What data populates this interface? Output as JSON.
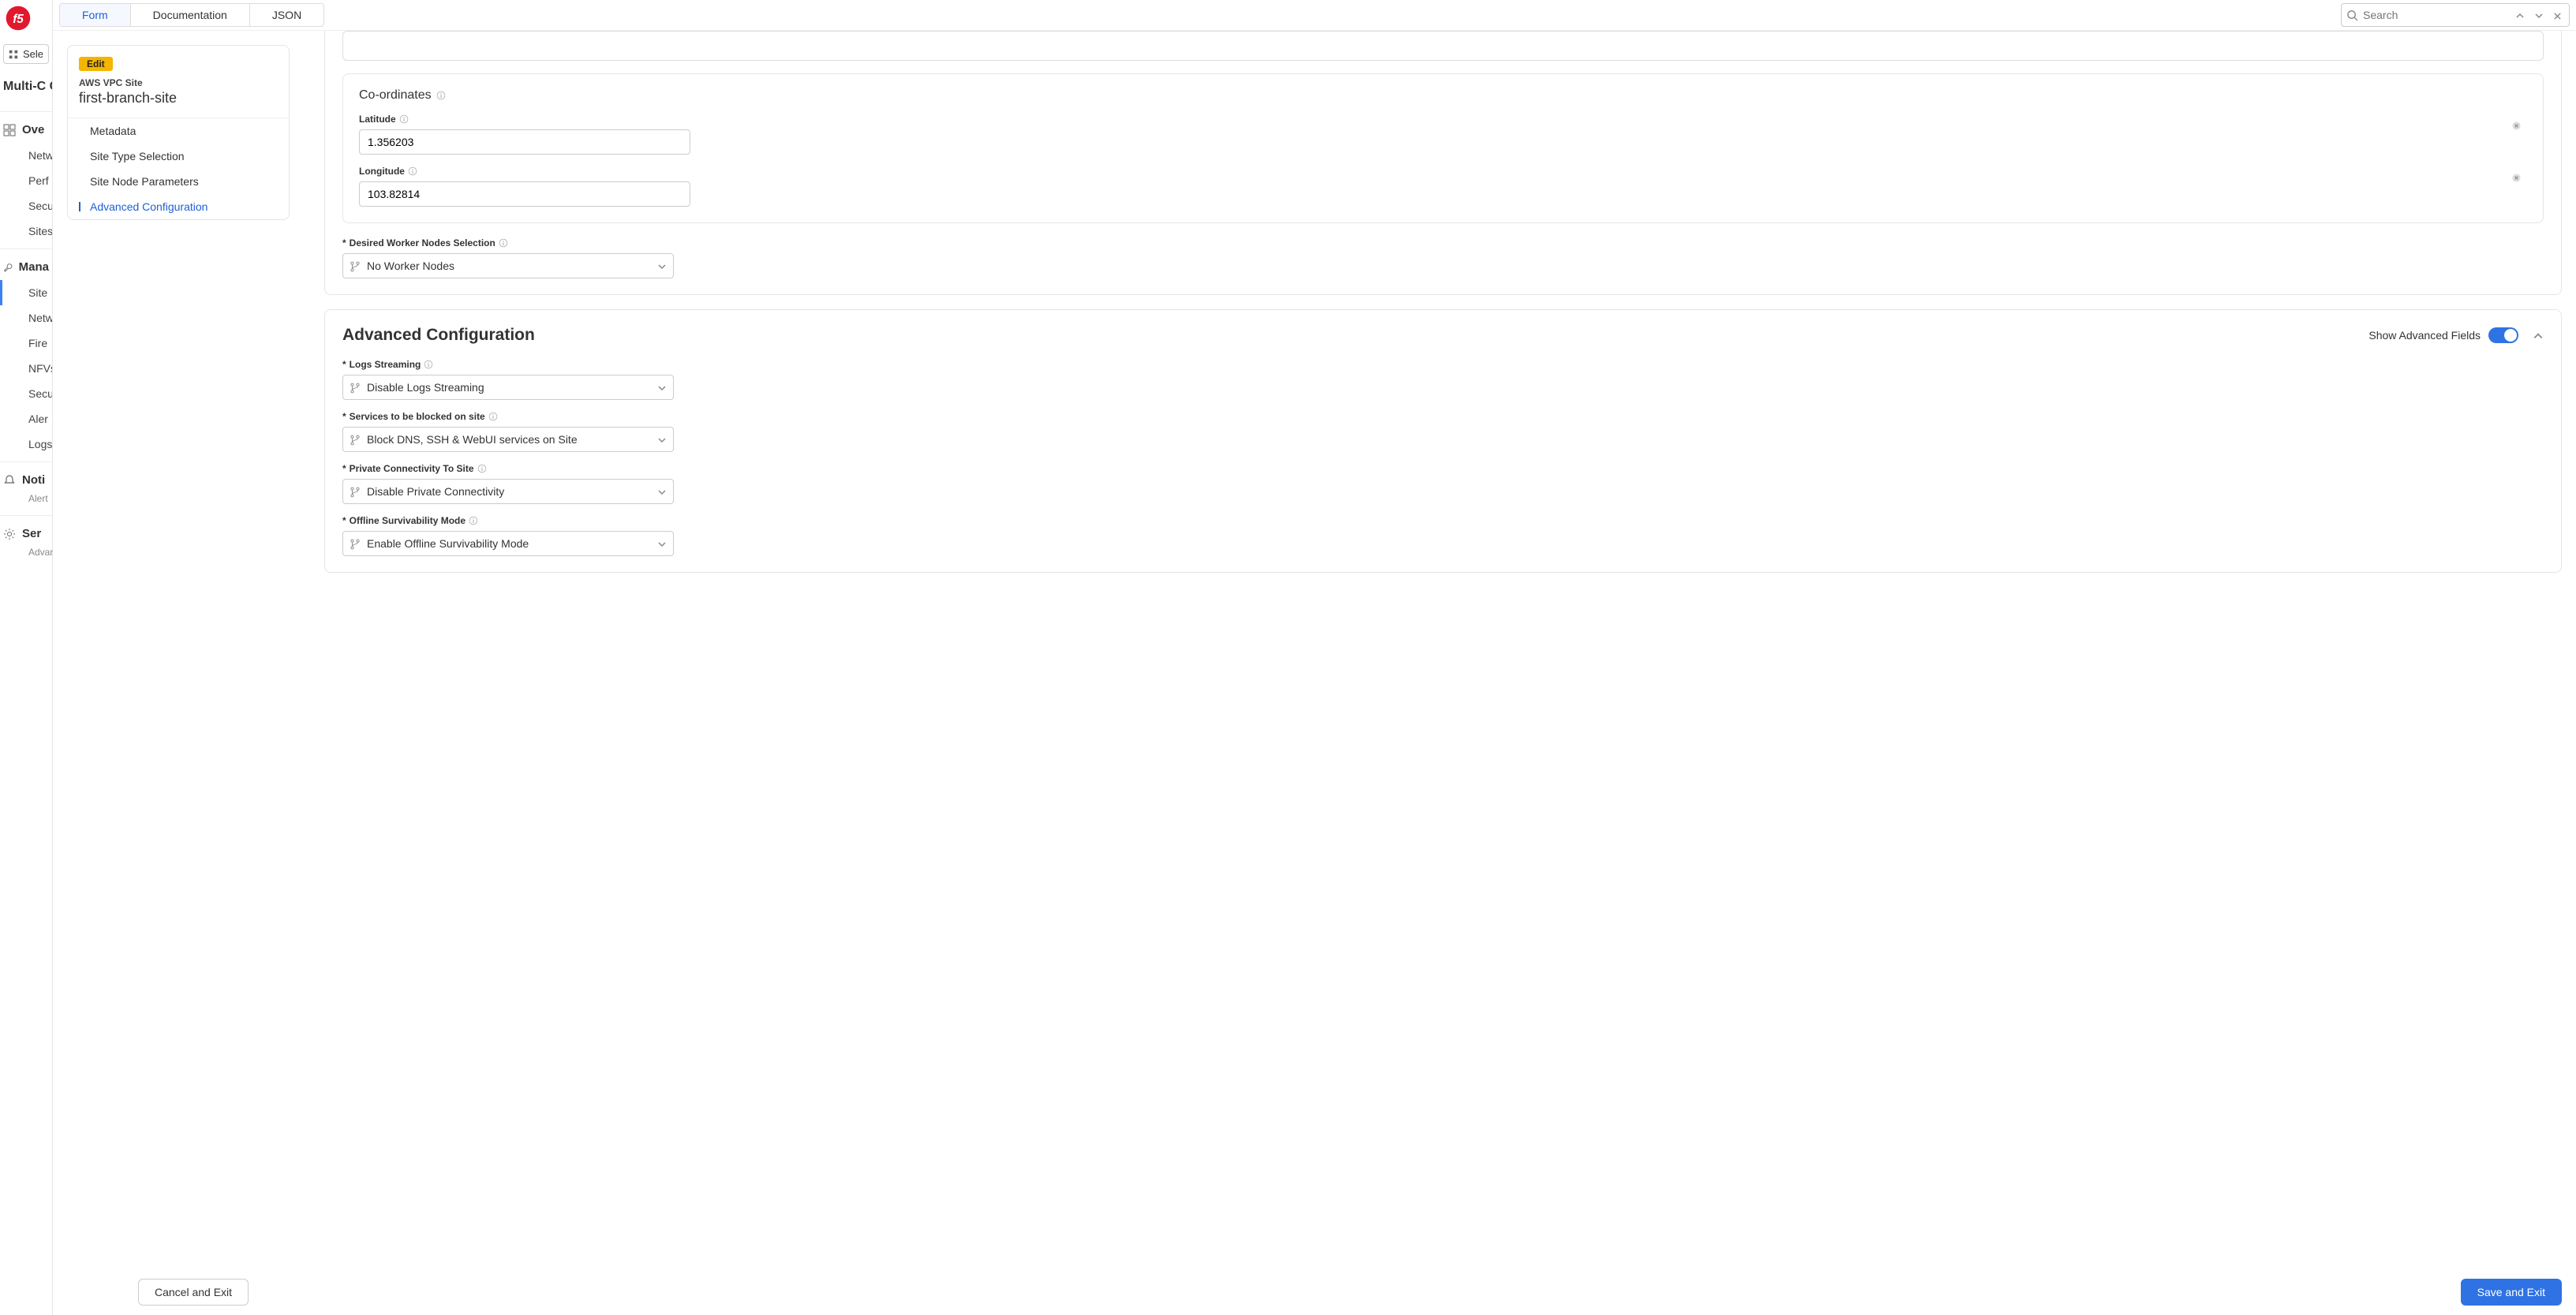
{
  "bg": {
    "selector_label": "Sele",
    "product": "Multi-C\nConnec",
    "sections": {
      "overview": "Ove",
      "overview_items": [
        "Netw",
        "Perf",
        "Secu",
        "Sites"
      ],
      "manage": "Mana",
      "manage_items": [
        "Site",
        "Netw",
        "Fire",
        "NFVs",
        "Secu",
        "Aler",
        "Logs"
      ],
      "notif": "Noti",
      "notif_sub": "Alert",
      "service": "Ser",
      "service_sub": "Advanced c"
    }
  },
  "toolbar": {
    "tabs": [
      "Form",
      "Documentation",
      "JSON"
    ],
    "search_placeholder": "Search"
  },
  "leftnav": {
    "badge": "Edit",
    "subtitle": "AWS VPC Site",
    "title": "first-branch-site",
    "items": [
      "Metadata",
      "Site Type Selection",
      "Site Node Parameters",
      "Advanced Configuration"
    ],
    "active_index": 3
  },
  "coords": {
    "title": "Co-ordinates",
    "lat_label": "Latitude",
    "lat_value": "1.356203",
    "lon_label": "Longitude",
    "lon_value": "103.82814"
  },
  "worker": {
    "label": "Desired Worker Nodes Selection",
    "value": "No Worker Nodes"
  },
  "advanced": {
    "title": "Advanced Configuration",
    "toggle_label": "Show Advanced Fields",
    "fields": [
      {
        "label": "Logs Streaming",
        "value": "Disable Logs Streaming"
      },
      {
        "label": "Services to be blocked on site",
        "value": "Block DNS, SSH & WebUI services on Site"
      },
      {
        "label": "Private Connectivity To Site",
        "value": "Disable Private Connectivity"
      },
      {
        "label": "Offline Survivability Mode",
        "value": "Enable Offline Survivability Mode"
      }
    ]
  },
  "footer": {
    "cancel": "Cancel and Exit",
    "save": "Save and Exit"
  }
}
